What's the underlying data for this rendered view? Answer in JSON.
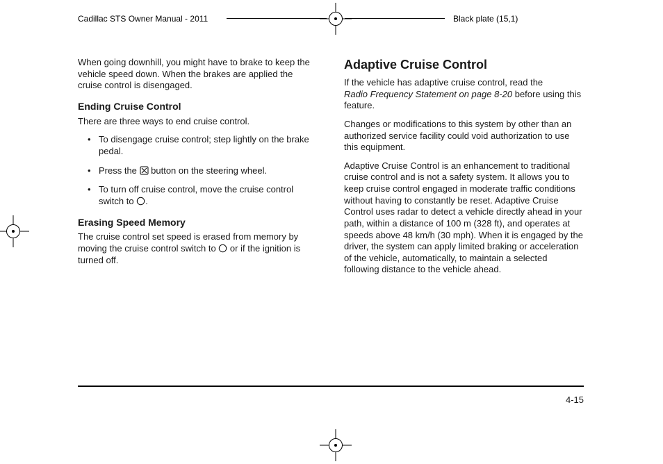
{
  "header": {
    "left": "Cadillac STS Owner Manual - 2011",
    "right": "Black plate (15,1)"
  },
  "left_col": {
    "intro_para": "When going downhill, you might have to brake to keep the vehicle speed down. When the brakes are applied the cruise control is disengaged.",
    "ending_heading": "Ending Cruise Control",
    "ending_intro": "There are three ways to end cruise control.",
    "bullets": {
      "b1": "To disengage cruise control; step lightly on the brake pedal.",
      "b2a": "Press the ",
      "b2b": " button on the steering wheel.",
      "b3a": "To turn off cruise control, move the cruise control switch to ",
      "b3b": "."
    },
    "erasing_heading": "Erasing Speed Memory",
    "erasing_para_a": "The cruise control set speed is erased from memory by moving the cruise control switch to ",
    "erasing_para_b": " or if the ignition is turned off."
  },
  "right_col": {
    "title": "Adaptive Cruise Control",
    "para1a": "If the vehicle has adaptive cruise control, read the ",
    "para1_ref": "Radio Frequency Statement on page 8‑20",
    "para1b": " before using this feature.",
    "para2": "Changes or modifications to this system by other than an authorized service facility could void authorization to use this equipment.",
    "para3": "Adaptive Cruise Control is an enhancement to traditional cruise control and is not a safety system. It allows you to keep cruise control engaged in moderate traffic conditions without having to constantly be reset. Adaptive Cruise Control uses radar to detect a vehicle directly ahead in your path, within a distance of 100 m (328 ft), and operates at speeds above 48 km/h (30 mph). When it is engaged by the driver, the system can apply limited braking or acceleration of the vehicle, automatically, to maintain a selected following distance to the vehicle ahead."
  },
  "page_number": "4-15"
}
